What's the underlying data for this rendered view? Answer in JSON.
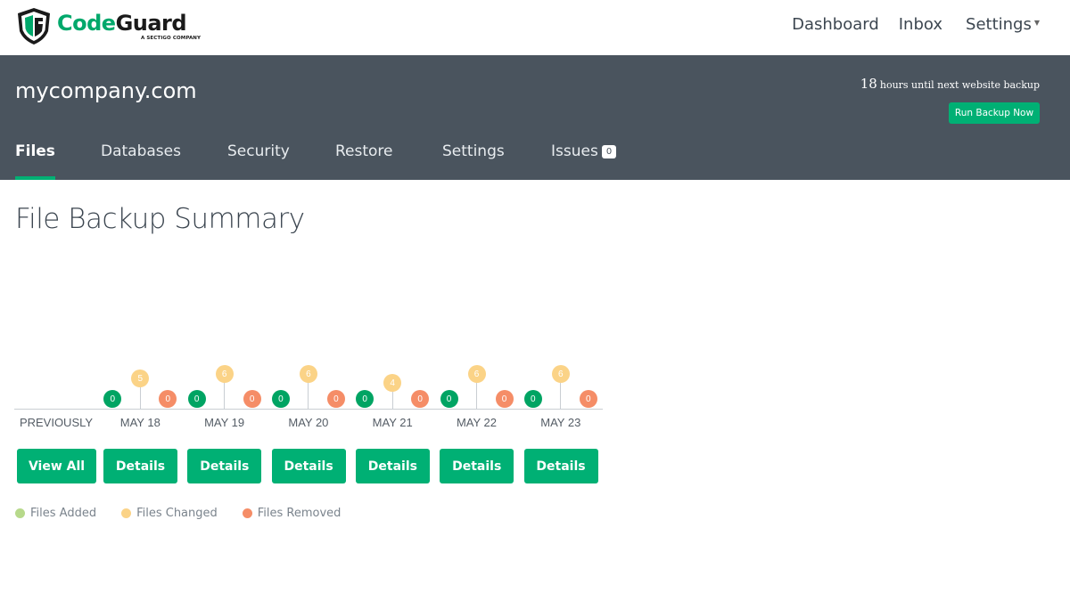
{
  "brand": {
    "name_part1": "Code",
    "name_part2": "Guard",
    "tagline": "A SECTIGO COMPANY"
  },
  "topnav": {
    "items": [
      {
        "label": "Dashboard"
      },
      {
        "label": "Inbox"
      },
      {
        "label": "Settings"
      }
    ]
  },
  "header": {
    "site_name": "mycompany.com",
    "hours": "18",
    "backup_text": "hours until next website backup",
    "run_backup_label": "Run Backup Now"
  },
  "tabs": [
    {
      "label": "Files",
      "active": true
    },
    {
      "label": "Databases",
      "active": false
    },
    {
      "label": "Security",
      "active": false
    },
    {
      "label": "Restore",
      "active": false
    },
    {
      "label": "Settings",
      "active": false
    },
    {
      "label": "Issues",
      "active": false,
      "badge": "0"
    }
  ],
  "page_title": "File Backup Summary",
  "colors": {
    "accent": "#00b074",
    "header_bg": "#4a545e",
    "files_added": "#00a463",
    "files_changed": "#fbd387",
    "files_removed": "#f58d67",
    "legend_added": "#b7d98b"
  },
  "chart_data": {
    "type": "scatter",
    "title": "File Backup Summary",
    "categories": [
      "PREVIOUSLY",
      "MAY 18",
      "MAY 19",
      "MAY 20",
      "MAY 21",
      "MAY 22",
      "MAY 23"
    ],
    "series": [
      {
        "name": "Files Added",
        "values": [
          null,
          0,
          0,
          0,
          0,
          0,
          0
        ]
      },
      {
        "name": "Files Changed",
        "values": [
          null,
          5,
          6,
          6,
          4,
          6,
          6
        ]
      },
      {
        "name": "Files Removed",
        "values": [
          null,
          0,
          0,
          0,
          0,
          0,
          0
        ]
      }
    ],
    "legend": [
      "Files Added",
      "Files Changed",
      "Files Removed"
    ],
    "legend_position": "bottom-left"
  },
  "buttons": {
    "view_all": "View All",
    "details": [
      "Details",
      "Details",
      "Details",
      "Details",
      "Details",
      "Details"
    ]
  },
  "legend": [
    {
      "label": "Files Added"
    },
    {
      "label": "Files Changed"
    },
    {
      "label": "Files Removed"
    }
  ]
}
